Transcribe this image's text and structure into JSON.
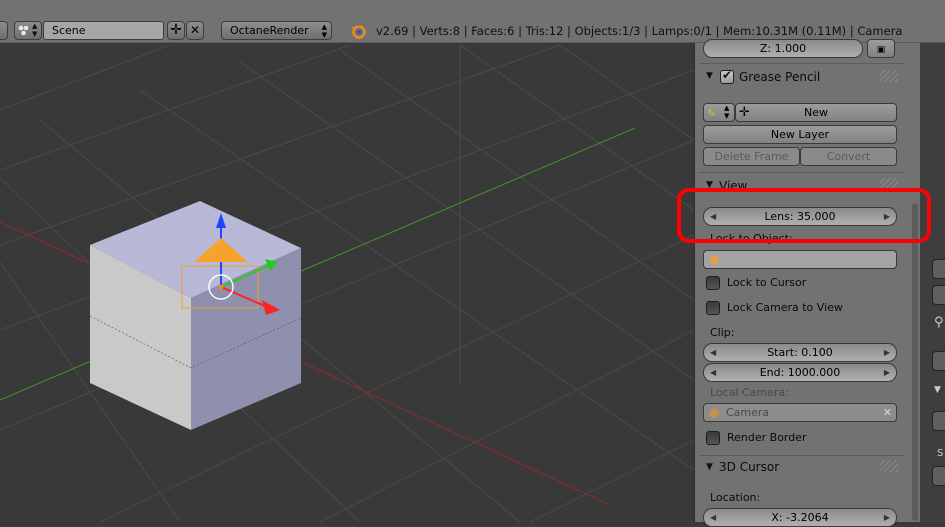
{
  "header": {
    "scene_name": "Scene",
    "renderer": "OctaneRender",
    "stats": "v2.69 | Verts:8 | Faces:6 | Tris:12 | Objects:1/3 | Lamps:0/1 | Mem:10.31M (0.11M) | Camera"
  },
  "panel": {
    "z_field": "Z: 1.000",
    "grease_pencil": {
      "title": "Grease Pencil",
      "new_label": "New",
      "new_layer_label": "New Layer",
      "delete_frame_label": "Delete Frame",
      "convert_label": "Convert"
    },
    "view": {
      "title": "View",
      "lens": "Lens: 35.000",
      "lock_to_object_label": "Lock to Object:",
      "lock_to_cursor_label": "Lock to Cursor",
      "lock_camera_label": "Lock Camera to View",
      "clip_label": "Clip:",
      "clip_start": "Start: 0.100",
      "clip_end": "End: 1000.000",
      "local_camera_label": "Local Camera:",
      "local_camera_value": "Camera",
      "render_border_label": "Render Border"
    },
    "cursor": {
      "title": "3D Cursor",
      "location_label": "Location:",
      "x_value": "X: -3.2064"
    }
  },
  "colors": {
    "highlight": "#ff0000",
    "panel_bg": "#727272",
    "viewport_bg": "#393939",
    "x_axis": "#8a2a2a",
    "y_axis": "#3f8a2a"
  }
}
